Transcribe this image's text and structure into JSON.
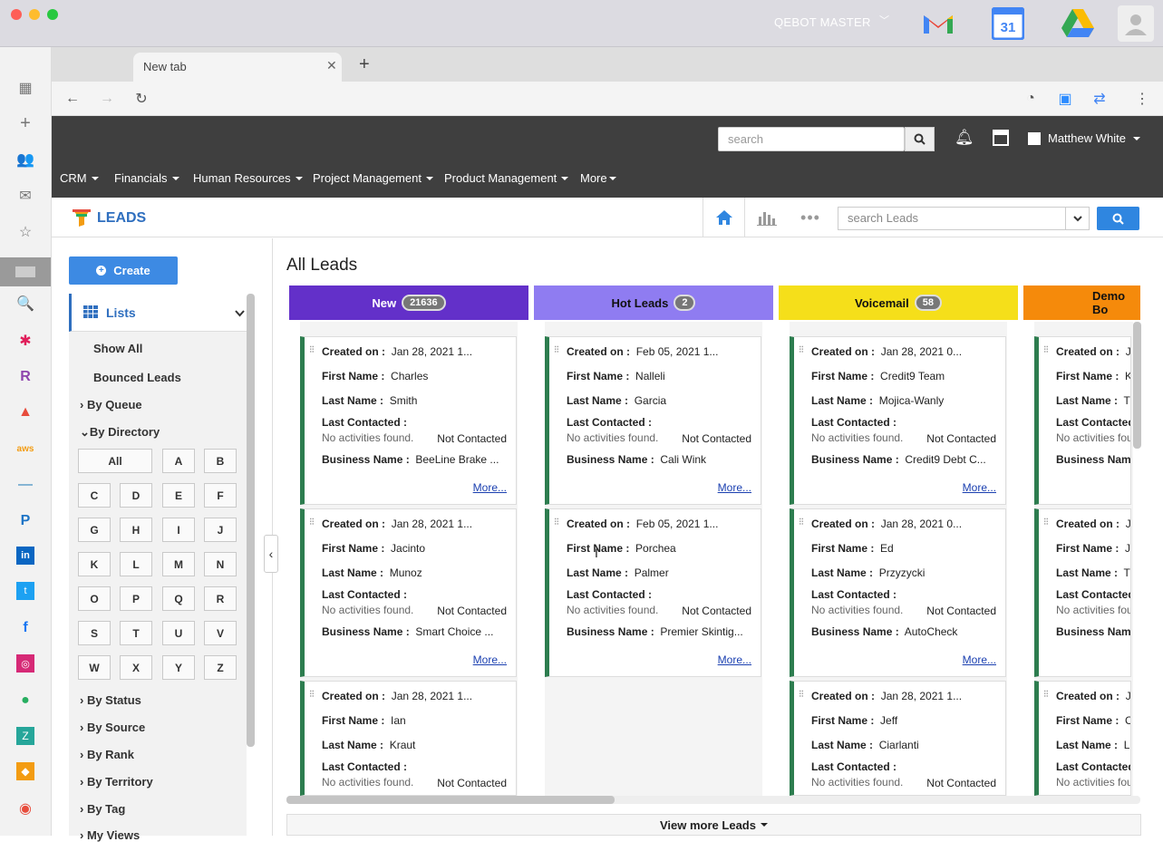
{
  "mac": {
    "app_name": "QEBOT MASTER",
    "calendar_day": "31"
  },
  "browser": {
    "tab_title": "New tab"
  },
  "header": {
    "search_placeholder": "search",
    "user_name": "Matthew White",
    "nav": [
      "CRM",
      "Financials",
      "Human Resources",
      "Project Management",
      "Product Management",
      "More"
    ]
  },
  "leads": {
    "title": "LEADS",
    "search_placeholder": "search Leads"
  },
  "sidebar": {
    "create_label": "Create",
    "lists_label": "Lists",
    "show_all": "Show All",
    "bounced": "Bounced Leads",
    "by_queue": "By Queue",
    "by_directory": "By Directory",
    "letters": [
      "All",
      "A",
      "B",
      "C",
      "D",
      "E",
      "F",
      "G",
      "H",
      "I",
      "J",
      "K",
      "L",
      "M",
      "N",
      "O",
      "P",
      "Q",
      "R",
      "S",
      "T",
      "U",
      "V",
      "W",
      "X",
      "Y",
      "Z"
    ],
    "filters": [
      "By Status",
      "By Source",
      "By Rank",
      "By Territory",
      "By Tag",
      "My Views"
    ]
  },
  "main": {
    "title": "All Leads",
    "view_more": "View more Leads",
    "labels": {
      "created": "Created on :",
      "first": "First Name :",
      "last": "Last Name :",
      "contacted": "Last Contacted :",
      "business": "Business Name :",
      "no_act": "No activities found.",
      "not_contacted": "Not Contacted",
      "more": "More..."
    },
    "columns": [
      {
        "name": "New",
        "count": "21636",
        "color": "#6330c9",
        "text_color": "#ffffff",
        "cards": [
          {
            "created": "Jan 28, 2021 1...",
            "first": "Charles",
            "last": "Smith",
            "business": "BeeLine Brake ..."
          },
          {
            "created": "Jan 28, 2021 1...",
            "first": "Jacinto",
            "last": "Munoz",
            "business": "Smart Choice ..."
          },
          {
            "created": "Jan 28, 2021 1...",
            "first": "Ian",
            "last": "Kraut",
            "business": ""
          }
        ]
      },
      {
        "name": "Hot Leads",
        "count": "2",
        "color": "#8f7cf1",
        "text_color": "#111111",
        "cards": [
          {
            "created": "Feb 05, 2021 1...",
            "first": "Nalleli",
            "last": "Garcia",
            "business": "Cali Wink"
          },
          {
            "created": "Feb 05, 2021 1...",
            "first": "Porchea",
            "last": "Palmer",
            "business": "Premier Skintig..."
          }
        ]
      },
      {
        "name": "Voicemail",
        "count": "58",
        "color": "#f5df1a",
        "text_color": "#111111",
        "cards": [
          {
            "created": "Jan 28, 2021 0...",
            "first": "Credit9 Team",
            "last": "Mojica-Wanly",
            "business": "Credit9 Debt C..."
          },
          {
            "created": "Jan 28, 2021 0...",
            "first": "Ed",
            "last": "Przyzycki",
            "business": "AutoCheck"
          },
          {
            "created": "Jan 28, 2021 1...",
            "first": "Jeff",
            "last": "Ciarlanti",
            "business": ""
          }
        ]
      },
      {
        "name": "Demo Bo",
        "count": "",
        "color": "#f58a0b",
        "text_color": "#111111",
        "cards": [
          {
            "created": "Ja",
            "first": "Ke",
            "last": "Tu",
            "business": ""
          },
          {
            "created": "Ja",
            "first": "Je",
            "last": "Th",
            "business": ""
          },
          {
            "created": "Ja",
            "first": "C",
            "last": "Lu",
            "business": ""
          }
        ]
      }
    ]
  }
}
